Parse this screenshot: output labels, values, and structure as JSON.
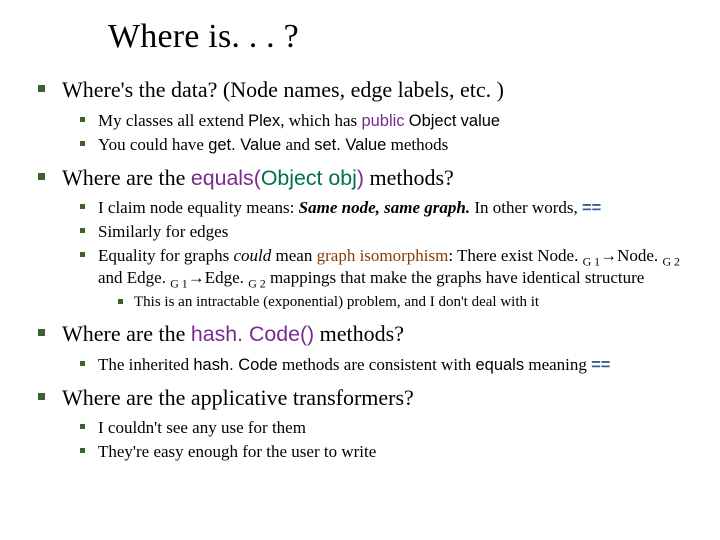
{
  "title": "Where is. . . ?",
  "q1": {
    "text": "Where's the data? (Node names, edge labels, etc. )",
    "sub": [
      {
        "pre": "My classes all extend ",
        "c1": "Plex",
        "mid": ", which has ",
        "kw": "public",
        "sp1": " ",
        "ty": "Object",
        "sp2": " ",
        "val": "value"
      },
      {
        "pre": "You could have ",
        "m1": "get. Value",
        "mid": " and ",
        "m2": "set. Value",
        "post": " methods"
      }
    ]
  },
  "q2": {
    "pre": "Where are the ",
    "meth": "equals",
    "paren_open": "(",
    "argtype": "Object",
    "sp": " ",
    "argname": "obj",
    "paren_close": ")",
    "post": " methods?",
    "sub": [
      {
        "pre": "I claim node equality means: ",
        "bi": "Same node, same graph.",
        "mid": " In other words, ",
        "op": "=="
      },
      {
        "t": "Similarly for edges"
      },
      {
        "pre": "Equality for graphs ",
        "ital": "could",
        "mid1": " mean ",
        "term": "graph isomorphism",
        "mid2": ": There exist Node. ",
        "g1": "G 1",
        "arrow1": "→",
        "n2": "Node. ",
        "g2": "G 2",
        "and": " and Edge. ",
        "g3": "G 1",
        "arrow2": "→",
        "e2": "Edge. ",
        "g4": "G 2",
        "tail": " mappings that make the graphs have identical structure"
      }
    ],
    "subsub": "This is an intractable (exponential) problem, and I don't deal with it"
  },
  "q3": {
    "pre": "Where are the ",
    "meth": "hash. Code()",
    "post": " methods?",
    "sub": {
      "pre": "The inherited ",
      "m": "hash. Code",
      "mid": " methods are consistent with ",
      "m2": "equals",
      "mid2": " meaning ",
      "op": "=="
    }
  },
  "q4": {
    "text": "Where are the applicative transformers?",
    "sub": [
      "I couldn't see any use for them",
      "They're easy enough for the user to write"
    ]
  }
}
